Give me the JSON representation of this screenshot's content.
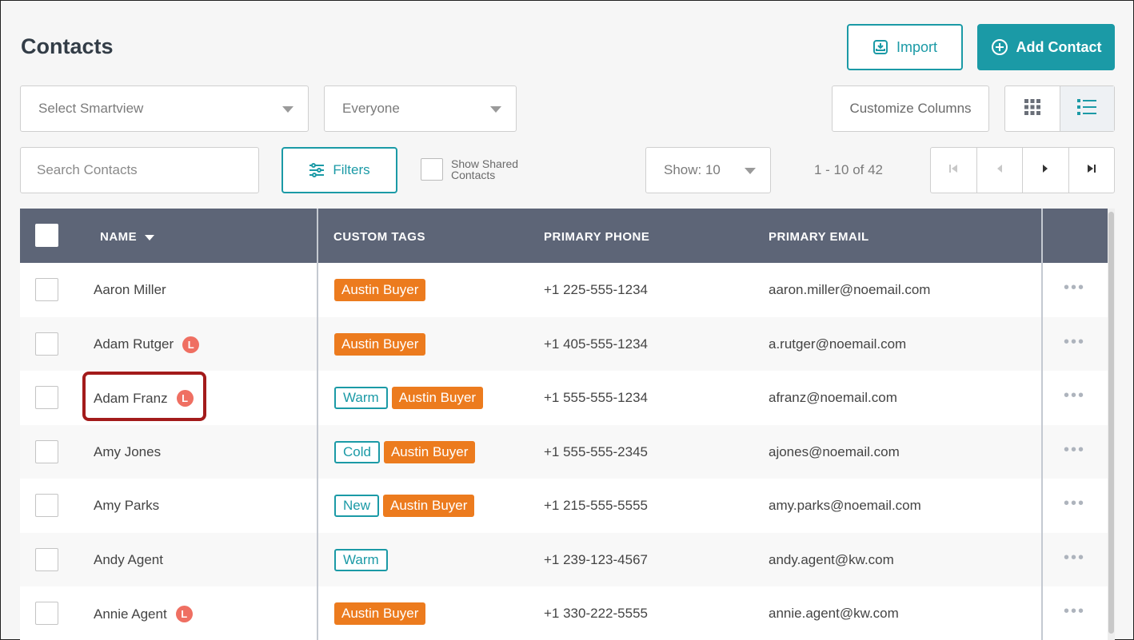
{
  "header": {
    "title": "Contacts",
    "import_label": "Import",
    "add_contact_label": "Add Contact"
  },
  "toolbar": {
    "smartview_placeholder": "Select Smartview",
    "everyone_label": "Everyone",
    "customize_columns_label": "Customize Columns",
    "search_placeholder": "Search Contacts",
    "filters_label": "Filters",
    "show_shared_label": "Show Shared Contacts",
    "show_label": "Show: 10",
    "range_label": "1 - 10 of 42"
  },
  "table": {
    "columns": {
      "name": "NAME",
      "custom_tags": "CUSTOM TAGS",
      "primary_phone": "PRIMARY PHONE",
      "primary_email": "PRIMARY EMAIL"
    },
    "rows": [
      {
        "name": "Aaron Miller",
        "lead_badge": "",
        "tags": [
          {
            "text": "Austin Buyer",
            "style": "orange"
          }
        ],
        "phone": "+1 225-555-1234",
        "email": "aaron.miller@noemail.com"
      },
      {
        "name": "Adam Rutger",
        "lead_badge": "L",
        "tags": [
          {
            "text": "Austin Buyer",
            "style": "orange"
          }
        ],
        "phone": "+1 405-555-1234",
        "email": "a.rutger@noemail.com"
      },
      {
        "name": "Adam Franz",
        "lead_badge": "L",
        "tags": [
          {
            "text": "Warm",
            "style": "teal"
          },
          {
            "text": "Austin Buyer",
            "style": "orange"
          }
        ],
        "phone": "+1 555-555-1234",
        "email": "afranz@noemail.com"
      },
      {
        "name": "Amy Jones",
        "lead_badge": "",
        "tags": [
          {
            "text": "Cold",
            "style": "teal"
          },
          {
            "text": "Austin Buyer",
            "style": "orange"
          }
        ],
        "phone": "+1 555-555-2345",
        "email": "ajones@noemail.com"
      },
      {
        "name": "Amy Parks",
        "lead_badge": "",
        "tags": [
          {
            "text": "New",
            "style": "teal"
          },
          {
            "text": "Austin Buyer",
            "style": "orange"
          }
        ],
        "phone": "+1 215-555-5555",
        "email": "amy.parks@noemail.com"
      },
      {
        "name": "Andy Agent",
        "lead_badge": "",
        "tags": [
          {
            "text": "Warm",
            "style": "teal"
          }
        ],
        "phone": "+1 239-123-4567",
        "email": "andy.agent@kw.com"
      },
      {
        "name": "Annie Agent",
        "lead_badge": "L",
        "tags": [
          {
            "text": "Austin Buyer",
            "style": "orange"
          }
        ],
        "phone": "+1 330-222-5555",
        "email": "annie.agent@kw.com"
      }
    ],
    "more_label": "•••"
  },
  "colors": {
    "accent": "#1b9aa6",
    "tag_orange": "#ec7b1e",
    "lead_badge": "#ef6f62",
    "header_bg": "#5d6577",
    "highlight": "#a31b1b"
  }
}
